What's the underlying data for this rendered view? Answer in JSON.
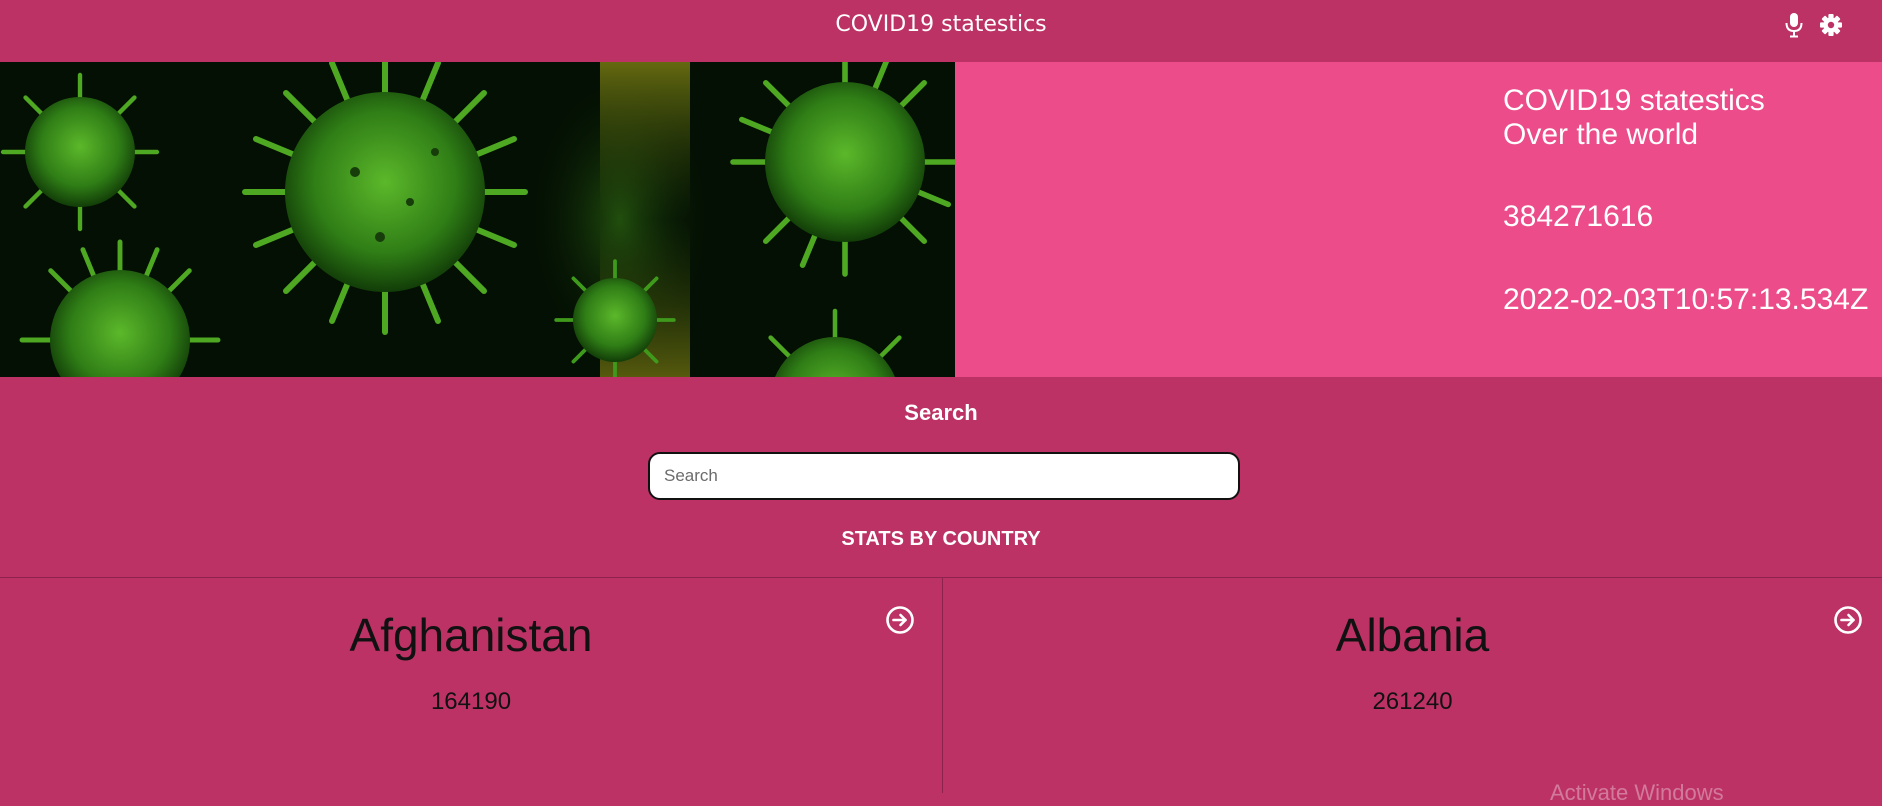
{
  "navbar": {
    "title": "COVID19 statestics",
    "icons": [
      "microphone-icon",
      "gear-icon"
    ]
  },
  "hero": {
    "image_alt": "green coronavirus particles",
    "heading_line1": "COVID19 statestics",
    "heading_line2": "Over the world",
    "total": "384271616",
    "updated": "2022-02-03T10:57:13.534Z"
  },
  "search": {
    "heading": "Search",
    "placeholder": "Search",
    "value": ""
  },
  "stats": {
    "heading": "STATS BY COUNTRY",
    "countries": [
      {
        "name": "Afghanistan",
        "value": "164190"
      },
      {
        "name": "Albania",
        "value": "261240"
      }
    ]
  },
  "colors": {
    "page_background": "#bc3265",
    "hero_background": "#ec4c8a",
    "text_light": "#ffffff",
    "text_dark": "#111111"
  },
  "watermark": "Activate Windows"
}
